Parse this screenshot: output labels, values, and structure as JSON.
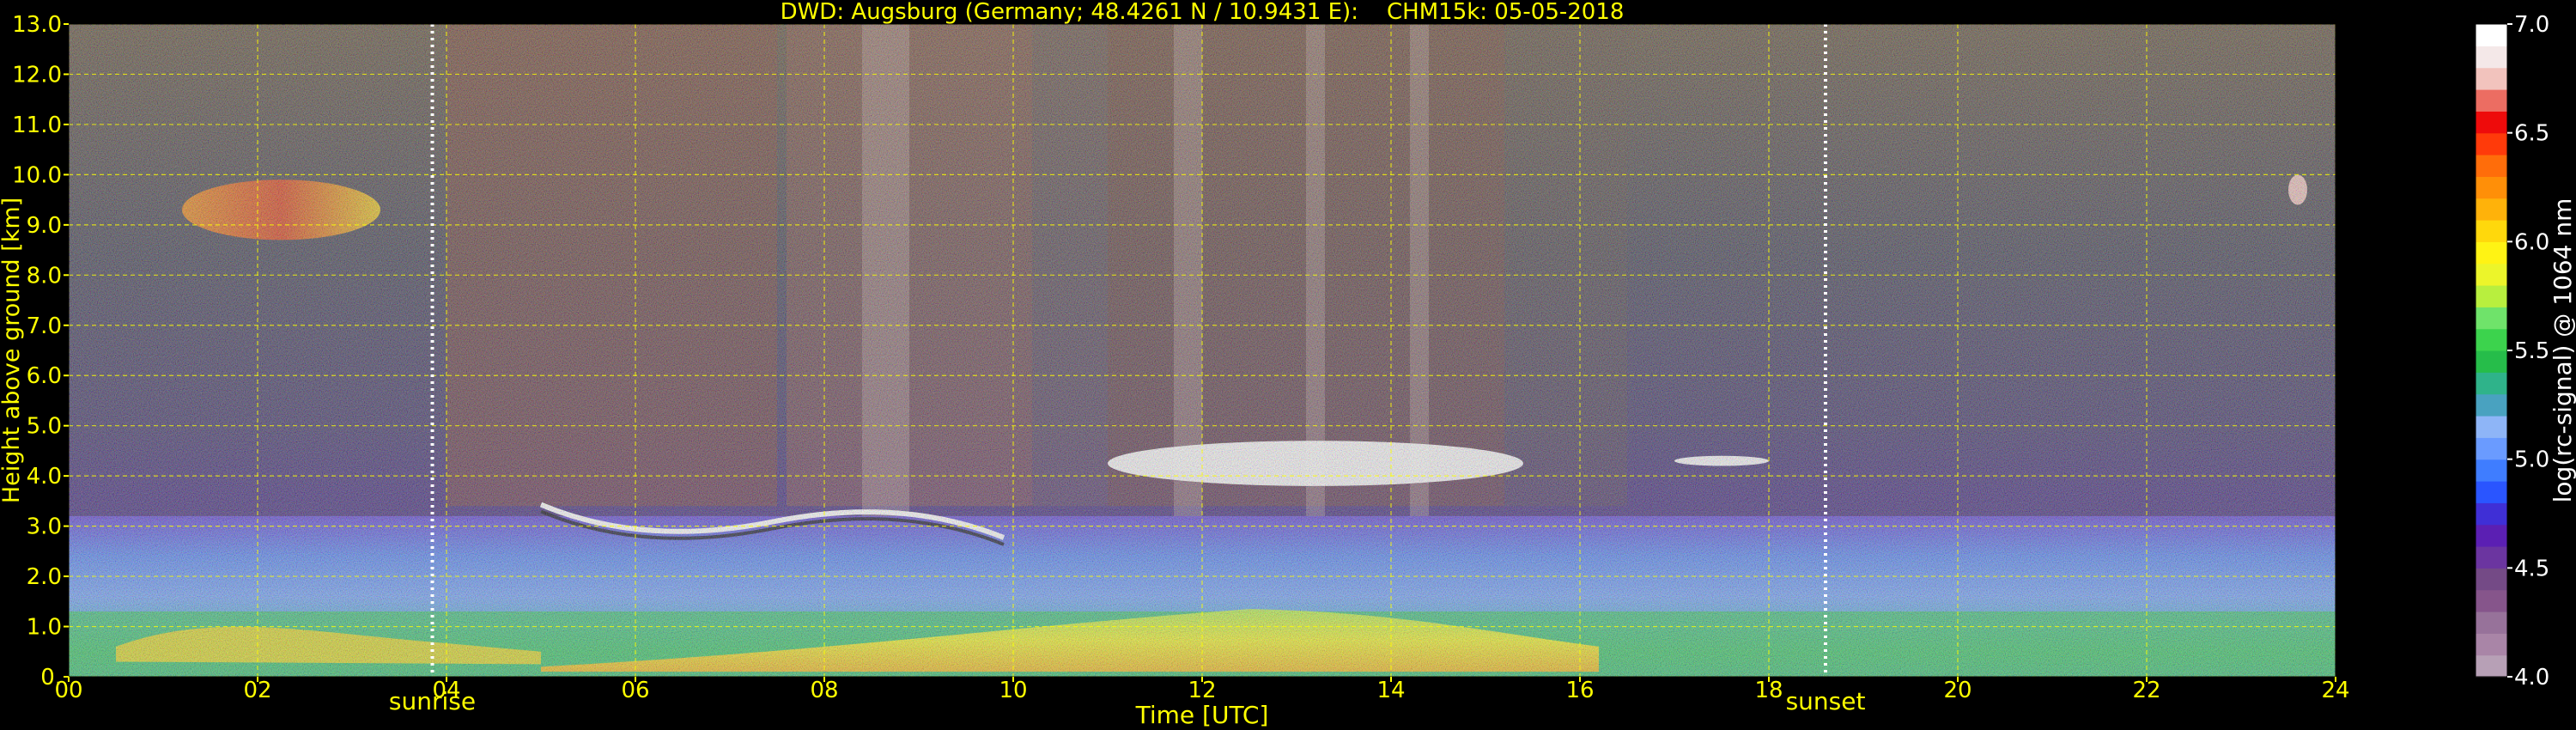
{
  "chart_data": {
    "type": "heatmap",
    "title": "DWD: Augsburg (Germany; 48.4261 N / 10.9431 E):    CHM15k: 05-05-2018",
    "xlabel": "Time [UTC]",
    "ylabel": "Height above ground [km]",
    "xlim": [
      0,
      24
    ],
    "ylim": [
      0,
      13
    ],
    "x_ticks": [
      "00",
      "02",
      "04",
      "06",
      "08",
      "10",
      "12",
      "14",
      "16",
      "18",
      "20",
      "22",
      "24"
    ],
    "x_tick_values": [
      0,
      2,
      4,
      6,
      8,
      10,
      12,
      14,
      16,
      18,
      20,
      22,
      24
    ],
    "y_ticks": [
      "0.",
      "1.0",
      "2.0",
      "3.0",
      "4.0",
      "5.0",
      "6.0",
      "7.0",
      "8.0",
      "9.0",
      "10.0",
      "11.0",
      "12.0",
      "13.0"
    ],
    "y_tick_values": [
      0,
      1,
      2,
      3,
      4,
      5,
      6,
      7,
      8,
      9,
      10,
      11,
      12,
      13
    ],
    "grid": true,
    "markers": [
      {
        "label": "sunrise",
        "time": 3.85
      },
      {
        "label": "sunset",
        "time": 18.6
      }
    ],
    "colorbar": {
      "label": "log(rc-signal) @ 1064 nm",
      "range": [
        4.0,
        7.0
      ],
      "ticks": [
        "4.0",
        "4.5",
        "5.0",
        "5.5",
        "6.0",
        "6.5",
        "7.0"
      ],
      "tick_values": [
        4.0,
        4.5,
        5.0,
        5.5,
        6.0,
        6.5,
        7.0
      ],
      "colors": [
        "#b7a0b6",
        "#a985a7",
        "#97729a",
        "#86558b",
        "#744a86",
        "#6b35a0",
        "#5b1fb3",
        "#3f2fd6",
        "#2a55ff",
        "#3f7dff",
        "#6a9bff",
        "#8eb5f7",
        "#49a2c0",
        "#2fb38a",
        "#26bd4a",
        "#3cd34d",
        "#6fe36a",
        "#b8ef3e",
        "#ecf52a",
        "#fff314",
        "#ffd80c",
        "#ffb20a",
        "#ff8f08",
        "#ff6d0a",
        "#ff3a0a",
        "#ee0b0b",
        "#ec6d62",
        "#f2c3bd",
        "#f4e8e8",
        "#ffffff"
      ]
    },
    "features": [
      {
        "name": "boundary layer",
        "t_start": 0,
        "t_end": 24,
        "h_bottom": 0,
        "h_top": 3.2
      },
      {
        "name": "cirrus",
        "t_start": 1.2,
        "t_end": 3.3,
        "h_bottom": 8.7,
        "h_top": 9.9
      },
      {
        "name": "cloud deck",
        "t_start": 5.0,
        "t_end": 9.9,
        "h_bottom": 2.6,
        "h_top": 3.6
      },
      {
        "name": "mid-level cloud",
        "t_start": 11.0,
        "t_end": 15.4,
        "h_bottom": 3.8,
        "h_top": 4.7
      },
      {
        "name": "mid-level cloud",
        "t_start": 17.0,
        "t_end": 18.0,
        "h_bottom": 4.2,
        "h_top": 4.4
      },
      {
        "name": "cloud",
        "t_start": 23.5,
        "t_end": 23.7,
        "h_bottom": 9.4,
        "h_top": 10.0
      }
    ]
  }
}
